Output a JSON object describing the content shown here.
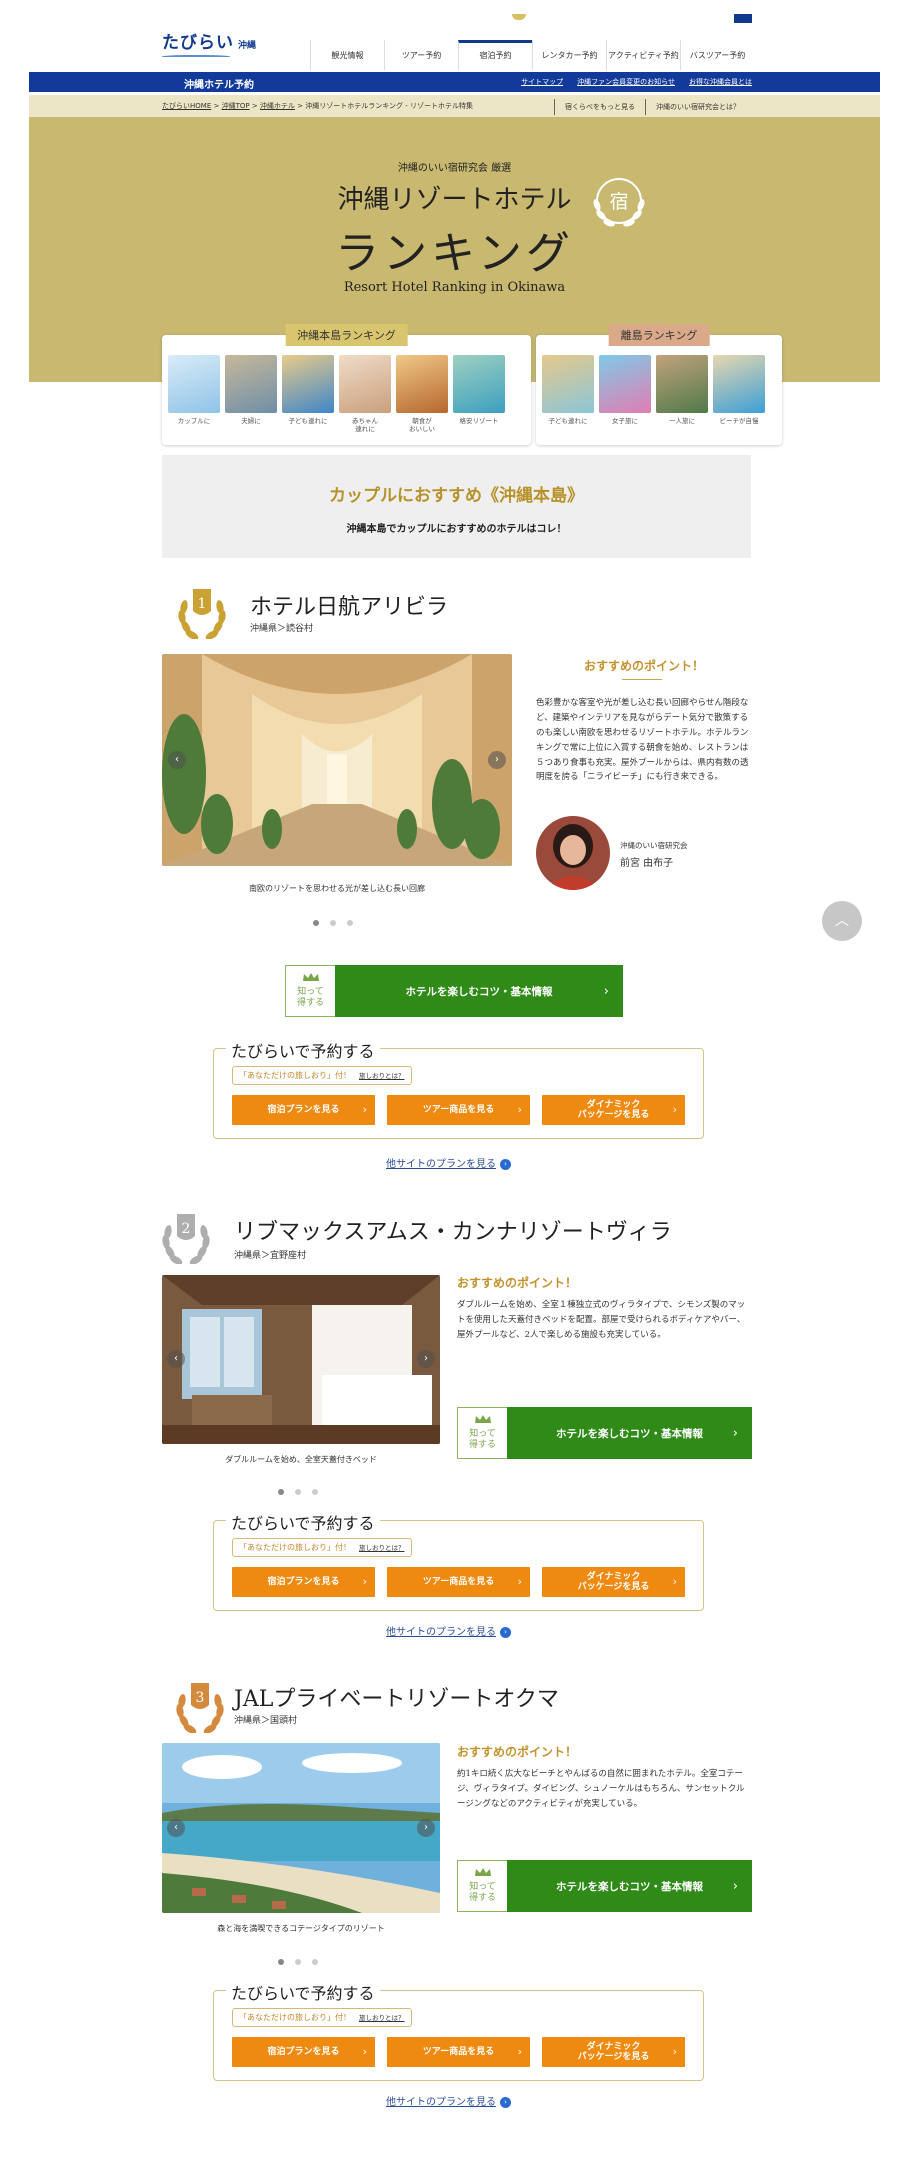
{
  "header": {
    "logo": "たびらい",
    "region": "沖縄",
    "nav": [
      "観光情報",
      "ツアー予約",
      "宿泊予約",
      "レンタカー予約",
      "アクティビティ予約",
      "バスツアー予約"
    ],
    "active_nav": 2
  },
  "bluebar": {
    "title": "沖縄ホテル予約",
    "links": [
      "サイトマップ",
      "沖縄ファン会員変更のお知らせ",
      "お得な沖縄会員とは"
    ]
  },
  "breadcrumb": {
    "items": [
      "たびらいHOME",
      "沖縄TOP",
      "沖縄ホテル"
    ],
    "current": "沖縄リゾートホテルランキング - リゾートホテル特集",
    "sublinks": [
      "宿くらべをもっと見る",
      "沖縄のいい宿研究会とは？"
    ]
  },
  "hero": {
    "subtitle": "沖縄のいい宿研究会 厳選",
    "title1": "沖縄リゾートホテル",
    "title2": "ランキング",
    "title_en": "Resort Hotel Ranking in Okinawa",
    "seal_char": "宿"
  },
  "rank_main": {
    "label": "沖縄本島ランキング",
    "items": [
      {
        "cap": "カップルに",
        "c1": "#8fc3e8",
        "c2": "#d9ecf7"
      },
      {
        "cap": "夫婦に",
        "c1": "#6e8fa8",
        "c2": "#c7b89a"
      },
      {
        "cap": "子ども連れに",
        "c1": "#3d86c9",
        "c2": "#eacb8a"
      },
      {
        "cap": "赤ちゃん\n連れに",
        "c1": "#c99f7d",
        "c2": "#f0dcc8"
      },
      {
        "cap": "朝食が\nおいしい",
        "c1": "#b6662d",
        "c2": "#f0c98a"
      },
      {
        "cap": "格安リゾート",
        "c1": "#3c9fc0",
        "c2": "#9fd0c0"
      }
    ]
  },
  "rank_isle": {
    "label": "離島ランキング",
    "items": [
      {
        "cap": "子ども連れに",
        "c1": "#8bc6d8",
        "c2": "#e6c88a"
      },
      {
        "cap": "女子旅に",
        "c1": "#e27db2",
        "c2": "#7fc9e6"
      },
      {
        "cap": "一人旅に",
        "c1": "#4f7a4a",
        "c2": "#c2a27c"
      },
      {
        "cap": "ビーチが自慢",
        "c1": "#3b9fd6",
        "c2": "#e7d7b0"
      }
    ]
  },
  "category": {
    "title": "カップルにおすすめ《沖縄本島》",
    "lead": "沖縄本島でカップルにおすすめのホテルはコレ！"
  },
  "hotels": [
    {
      "rank": "1",
      "name": "ホテル日航アリビラ",
      "location": "沖縄県＞読谷村",
      "caption": "南欧のリゾートを思わせる光が差し込む長い回廊",
      "point_title": "おすすめのポイント！",
      "point": "色彩豊かな客室や光が差し込む長い回廊やらせん階段など、建築やインテリアを見ながらデート気分で散策するのも楽しい南欧を思わせるリゾートホテル。ホテルランキングで常に上位に入賞する朝食を始め、レストランは５つあり食事も充実。屋外プールからは、県内有数の透明度を誇る「ニライビーチ」にも行き来できる。",
      "expert_org": "沖縄のいい宿研究会",
      "expert_name": "前宮 由布子",
      "medal_color": "#c9a233"
    },
    {
      "rank": "2",
      "name": "リブマックスアムス・カンナリゾートヴィラ",
      "location": "沖縄県＞宜野座村",
      "caption": "ダブルルームを始め、全室天蓋付きベッド",
      "point_title": "おすすめのポイント！",
      "point": "ダブルルームを始め、全室１棟独立式のヴィラタイプで、シモンズ製のマットを使用した天蓋付きベッドを配置。部屋で受けられるボディケアやバー、屋外プールなど、2人で楽しめる施設も充実している。",
      "medal_color": "#aeaeae"
    },
    {
      "rank": "3",
      "name": "JALプライベートリゾートオクマ",
      "location": "沖縄県＞国頭村",
      "caption": "森と海を満喫できるコテージタイプのリゾート",
      "point_title": "おすすめのポイント！",
      "point": "約1キロ続く広大なビーチとやんばるの自然に囲まれたホテル。全室コテージ、ヴィラタイプ。ダイビング、シュノーケルはもちろん、サンセットクルージングなどのアクティビティが充実している。",
      "medal_color": "#d48a3c"
    }
  ],
  "common": {
    "know_label": "知って\n得する",
    "tips_button": "ホテルを楽しむコツ・基本情報",
    "book_title": "たびらいで予約する",
    "shiori": "「あなただけの旅しおり」付！",
    "shiori_link": "旅しおりとは？",
    "btn_stay": "宿泊プランを見る",
    "btn_tour": "ツアー商品を見る",
    "btn_dynamic": "ダイナミック\nパッケージを見る",
    "other_plans": "他サイトのプランを見る",
    "chevron": "›",
    "arrow_left": "‹",
    "arrow_right": "›",
    "totop": "︿"
  },
  "colors": {
    "brand_blue": "#123a9a",
    "hero_gold": "#c8b870",
    "accent_orange": "#ee8a0f",
    "accent_green": "#2f8a18"
  }
}
